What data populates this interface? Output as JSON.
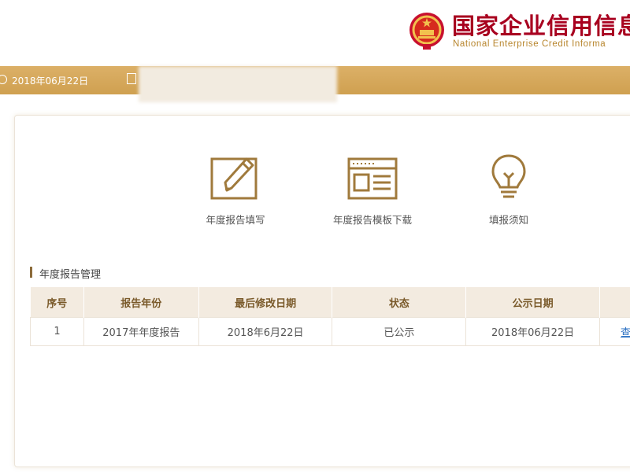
{
  "header": {
    "title": "国家企业信用信息",
    "subtitle": "National  Enterprise  Credit  Informa",
    "colors": {
      "title": "#a8001f",
      "subtitle": "#b8862e",
      "accent": "#d7a858"
    }
  },
  "topbar": {
    "date": "2018年06月22日",
    "company_name_hidden": true
  },
  "actions": [
    {
      "label": "年度报告填写",
      "icon": "edit-icon"
    },
    {
      "label": "年度报告模板下载",
      "icon": "template-icon"
    },
    {
      "label": "填报须知",
      "icon": "lightbulb-icon"
    }
  ],
  "section": {
    "title": "年度报告管理"
  },
  "table": {
    "headers": [
      "序号",
      "报告年份",
      "最后修改日期",
      "状态",
      "公示日期",
      ""
    ],
    "rows": [
      [
        "1",
        "2017年年度报告",
        "2018年6月22日",
        "已公示",
        "2018年06月22日",
        "查看"
      ]
    ]
  }
}
